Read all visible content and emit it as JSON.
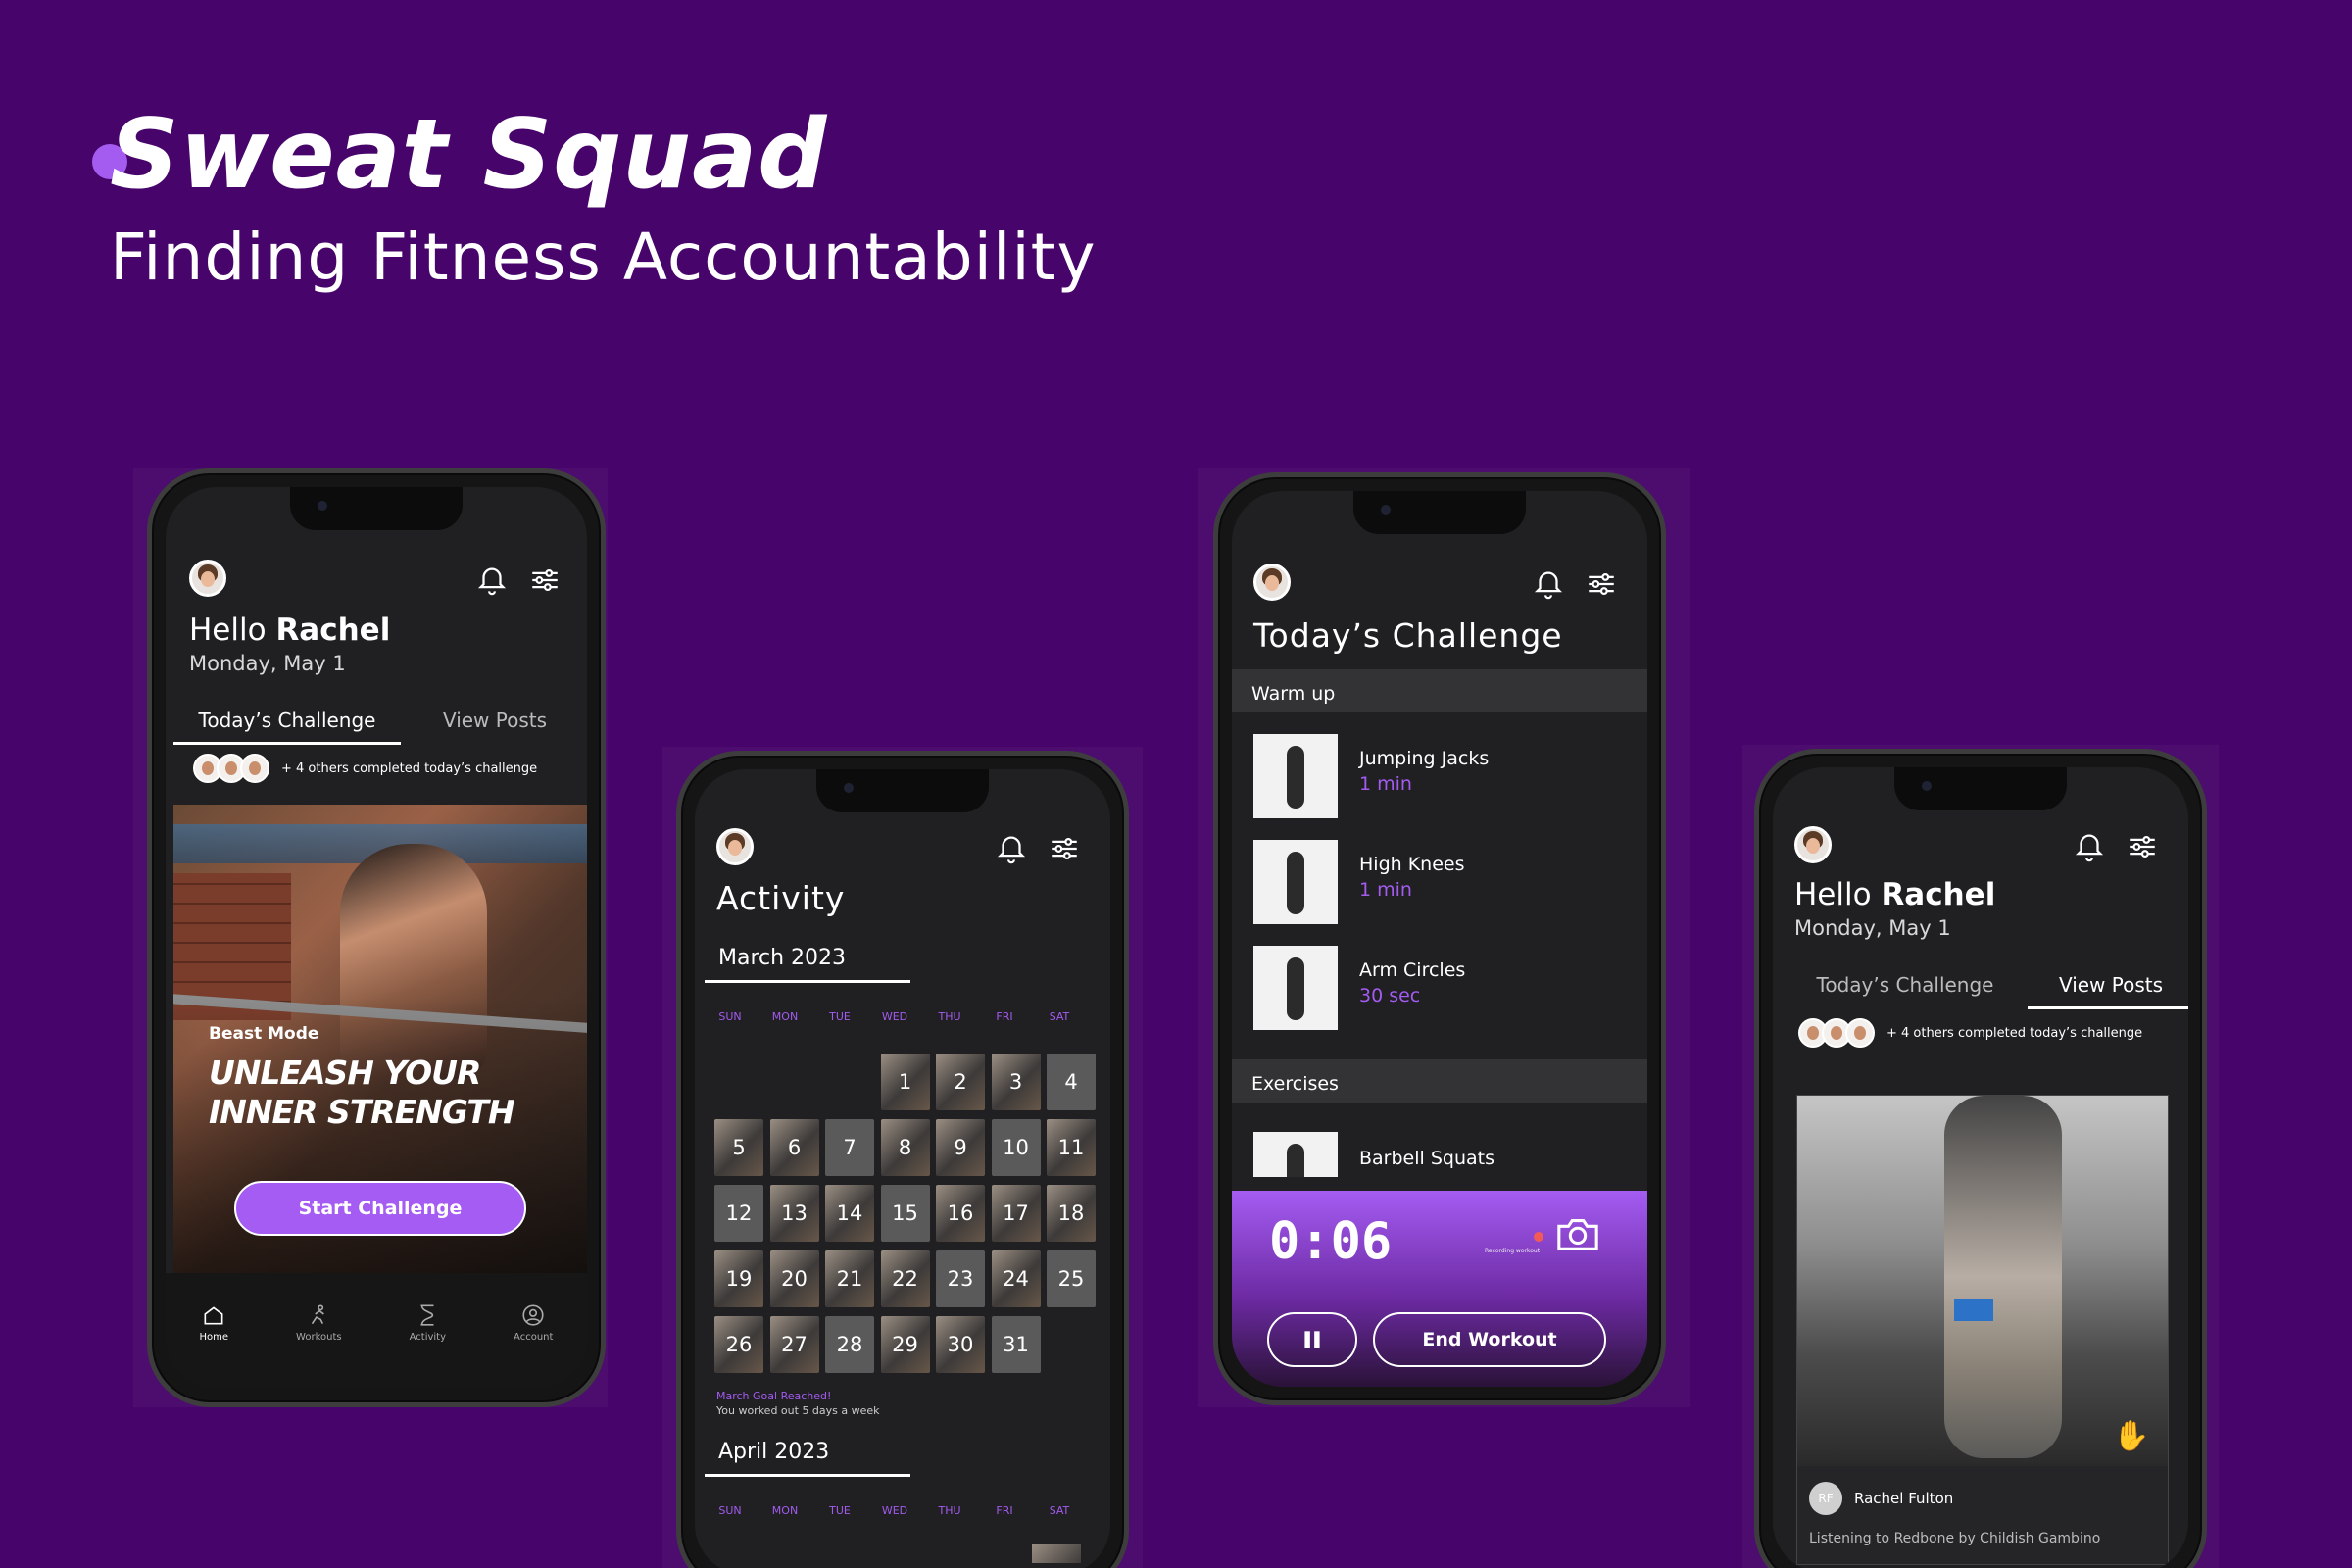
{
  "hero": {
    "title": "Sweat Squad",
    "subtitle": "Finding Fitness Accountability"
  },
  "colors": {
    "background": "#47046a",
    "accent": "#a45cf2",
    "screen": "#202022"
  },
  "home": {
    "greeting_prefix": "Hello",
    "greeting_name": "Rachel",
    "date": "Monday, May 1",
    "tabs": [
      "Today’s Challenge",
      "View Posts"
    ],
    "others_text": "+ 4 others completed today’s challenge",
    "badge": "Beast Mode",
    "headline_1": "UNLEASH YOUR",
    "headline_2": "INNER STRENGTH",
    "cta": "Start Challenge",
    "nav": [
      "Home",
      "Workouts",
      "Activity",
      "Account"
    ]
  },
  "activity": {
    "title": "Activity",
    "month_1": "March 2023",
    "month_2": "April 2023",
    "weekdays": [
      "SUN",
      "MON",
      "TUE",
      "WED",
      "THU",
      "FRI",
      "SAT"
    ],
    "days": [
      "1",
      "2",
      "3",
      "4",
      "5",
      "6",
      "7",
      "8",
      "9",
      "10",
      "11",
      "12",
      "13",
      "14",
      "15",
      "16",
      "17",
      "18",
      "19",
      "20",
      "21",
      "22",
      "23",
      "24",
      "25",
      "26",
      "27",
      "28",
      "29",
      "30",
      "31"
    ],
    "goal_line_1": "March Goal Reached!",
    "goal_line_2": "You worked out 5 days a week"
  },
  "challenge": {
    "title": "Today’s Challenge",
    "warmup_label": "Warm up",
    "warmup": [
      {
        "name": "Jumping Jacks",
        "duration": "1 min"
      },
      {
        "name": "High Knees",
        "duration": "1 min"
      },
      {
        "name": "Arm Circles",
        "duration": "30 sec"
      }
    ],
    "exercises_label": "Exercises",
    "exercise_1": "Barbell Squats",
    "timer": "0:06",
    "recording_label": "Recording workout",
    "end_label": "End Workout"
  },
  "posts": {
    "greeting_prefix": "Hello",
    "greeting_name": "Rachel",
    "date": "Monday, May 1",
    "tabs": [
      "Today’s Challenge",
      "View Posts"
    ],
    "others_text": "+ 4 others completed today’s challenge",
    "poster_initials": "RF",
    "poster_name": "Rachel Fulton",
    "listening": "Listening to Redbone by Childish Gambino"
  }
}
